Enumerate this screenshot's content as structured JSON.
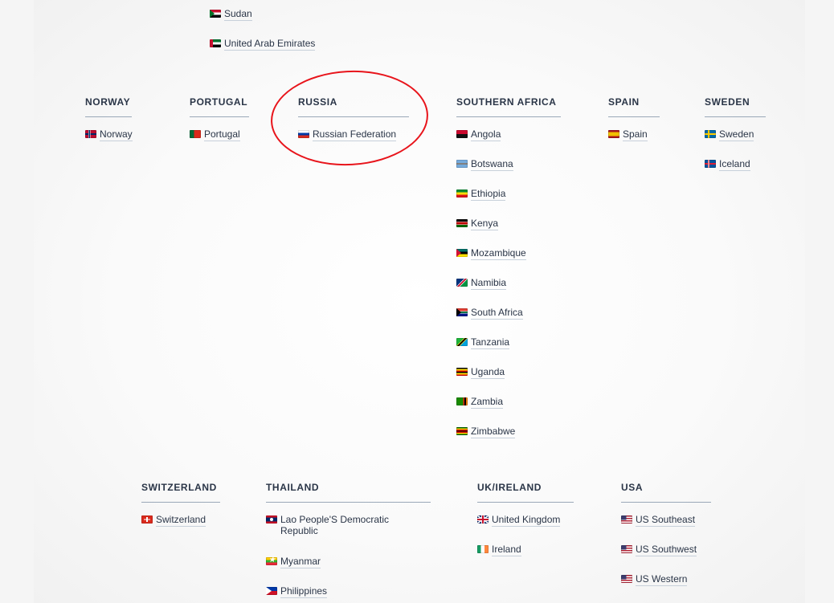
{
  "top_list": {
    "items": [
      {
        "label": "Sudan",
        "flag": "sudan-flag-icon"
      },
      {
        "label": "United Arab Emirates",
        "flag": "uae-flag-icon"
      }
    ]
  },
  "regions": {
    "norway": {
      "title": "NORWAY",
      "items": [
        {
          "label": "Norway",
          "flag": "norway-flag-icon"
        }
      ]
    },
    "portugal": {
      "title": "PORTUGAL",
      "items": [
        {
          "label": "Portugal",
          "flag": "portugal-flag-icon"
        }
      ]
    },
    "russia": {
      "title": "RUSSIA",
      "items": [
        {
          "label": "Russian Federation",
          "flag": "russia-flag-icon"
        }
      ]
    },
    "southern_africa": {
      "title": "SOUTHERN AFRICA",
      "items": [
        {
          "label": "Angola",
          "flag": "angola-flag-icon"
        },
        {
          "label": "Botswana",
          "flag": "botswana-flag-icon"
        },
        {
          "label": "Ethiopia",
          "flag": "ethiopia-flag-icon"
        },
        {
          "label": "Kenya",
          "flag": "kenya-flag-icon"
        },
        {
          "label": "Mozambique",
          "flag": "mozambique-flag-icon"
        },
        {
          "label": "Namibia",
          "flag": "namibia-flag-icon"
        },
        {
          "label": "South Africa",
          "flag": "south-africa-flag-icon"
        },
        {
          "label": "Tanzania",
          "flag": "tanzania-flag-icon"
        },
        {
          "label": "Uganda",
          "flag": "uganda-flag-icon"
        },
        {
          "label": "Zambia",
          "flag": "zambia-flag-icon"
        },
        {
          "label": "Zimbabwe",
          "flag": "zimbabwe-flag-icon"
        }
      ]
    },
    "spain": {
      "title": "SPAIN",
      "items": [
        {
          "label": "Spain",
          "flag": "spain-flag-icon"
        }
      ]
    },
    "sweden": {
      "title": "SWEDEN",
      "items": [
        {
          "label": "Sweden",
          "flag": "sweden-flag-icon"
        },
        {
          "label": "Iceland",
          "flag": "iceland-flag-icon"
        }
      ]
    },
    "switzerland": {
      "title": "SWITZERLAND",
      "items": [
        {
          "label": "Switzerland",
          "flag": "switzerland-flag-icon"
        }
      ]
    },
    "thailand": {
      "title": "THAILAND",
      "items": [
        {
          "label": "Lao People'S Democratic Republic",
          "flag": "laos-flag-icon"
        },
        {
          "label": "Myanmar",
          "flag": "myanmar-flag-icon"
        },
        {
          "label": "Philippines",
          "flag": "philippines-flag-icon"
        }
      ]
    },
    "uk_ireland": {
      "title": "UK/IRELAND",
      "items": [
        {
          "label": "United Kingdom",
          "flag": "uk-flag-icon"
        },
        {
          "label": "Ireland",
          "flag": "ireland-flag-icon"
        }
      ]
    },
    "usa": {
      "title": "USA",
      "items": [
        {
          "label": "US Southeast",
          "flag": "us-flag-icon"
        },
        {
          "label": "US Southwest",
          "flag": "us-flag-icon"
        },
        {
          "label": "US Western",
          "flag": "us-flag-icon"
        }
      ]
    }
  },
  "colors": {
    "heading": "#2a3547",
    "link": "#2a3547",
    "highlight_circle": "#e8141b"
  }
}
